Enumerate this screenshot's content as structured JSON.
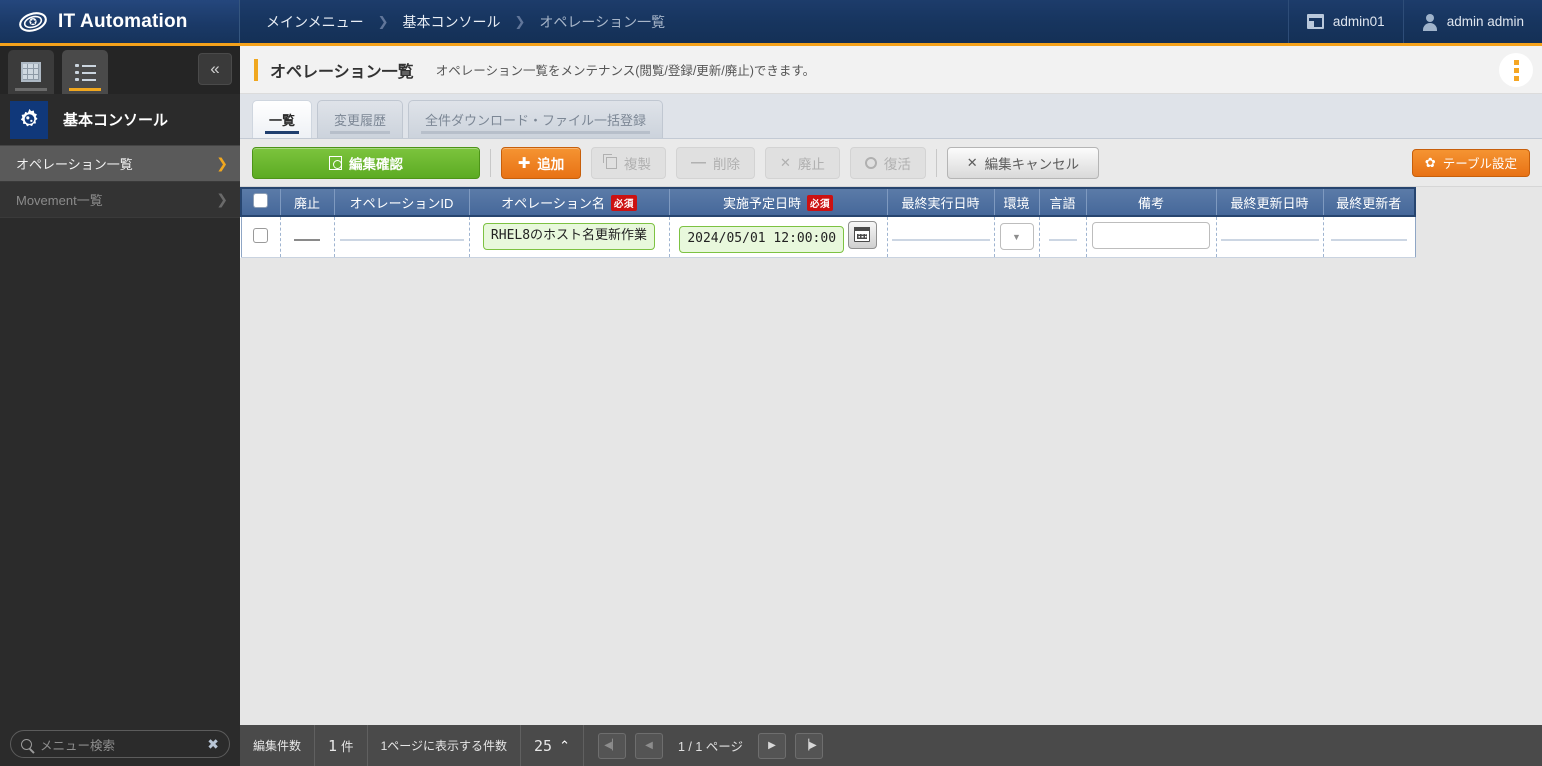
{
  "topbar": {
    "brand": "IT Automation",
    "breadcrumbs": [
      {
        "label": "メインメニュー",
        "dim": false
      },
      {
        "label": "基本コンソール",
        "dim": false
      },
      {
        "label": "オペレーション一覧",
        "dim": true
      }
    ],
    "separator": "❯",
    "workspace": "admin01",
    "user": "admin admin"
  },
  "sidebar": {
    "tabs": [
      {
        "name": "grid-view",
        "active": false
      },
      {
        "name": "list-view",
        "active": true
      }
    ],
    "collapse_label": "«",
    "section_title": "基本コンソール",
    "items": [
      {
        "label": "オペレーション一覧",
        "selected": true,
        "arrow": "❯"
      },
      {
        "label": "Movement一覧",
        "selected": false,
        "arrow": "❯"
      }
    ],
    "search_placeholder": "メニュー検索",
    "search_clear": "✖"
  },
  "page": {
    "title": "オペレーション一覧",
    "description": "オペレーション一覧をメンテナンス(閲覧/登録/更新/廃止)できます。",
    "accent_color": "#f0a71f"
  },
  "tabs": [
    {
      "label": "一覧",
      "active": true
    },
    {
      "label": "変更履歴",
      "active": false
    },
    {
      "label": "全件ダウンロード・ファイル一括登録",
      "active": false
    }
  ],
  "toolbar": {
    "confirm_label": "編集確認",
    "add_label": "追加",
    "duplicate_label": "複製",
    "delete_label": "削除",
    "discard_label": "廃止",
    "restore_label": "復活",
    "cancel_label": "編集キャンセル",
    "table_settings_label": "テーブル設定",
    "green": "#5cab23",
    "orange": "#e87215"
  },
  "table": {
    "columns": [
      {
        "label": "",
        "name": "select-all",
        "required": false
      },
      {
        "label": "廃止",
        "name": "discarded",
        "required": false
      },
      {
        "label": "オペレーションID",
        "name": "operation-id",
        "required": false
      },
      {
        "label": "オペレーション名",
        "name": "operation-name",
        "required": true
      },
      {
        "label": "実施予定日時",
        "name": "scheduled-datetime",
        "required": true
      },
      {
        "label": "最終実行日時",
        "name": "last-execution-datetime",
        "required": false
      },
      {
        "label": "環境",
        "name": "environment",
        "required": false
      },
      {
        "label": "言語",
        "name": "language",
        "required": false
      },
      {
        "label": "備考",
        "name": "remarks",
        "required": false
      },
      {
        "label": "最終更新日時",
        "name": "last-update-datetime",
        "required": false
      },
      {
        "label": "最終更新者",
        "name": "last-updater",
        "required": false
      }
    ],
    "required_badge": "必須",
    "rows": [
      {
        "discarded": "—",
        "operation_id": "",
        "operation_name": "RHEL8のホスト名更新作業",
        "scheduled_datetime": "2024/05/01 12:00:00",
        "last_execution": "",
        "environment": "",
        "language": "—",
        "remarks": "",
        "last_update": "",
        "last_updater": ""
      }
    ]
  },
  "footer": {
    "edit_count_label": "編集件数",
    "edit_count_value": "1",
    "edit_count_unit": "件",
    "per_page_label": "1ページに表示する件数",
    "per_page_value": "25",
    "per_page_caret": "⌃",
    "first_page_icon": "⏮",
    "prev_page_icon": "◀",
    "page_text": "1 / 1 ページ",
    "next_page_icon": "▶",
    "last_page_icon": "⏭"
  }
}
